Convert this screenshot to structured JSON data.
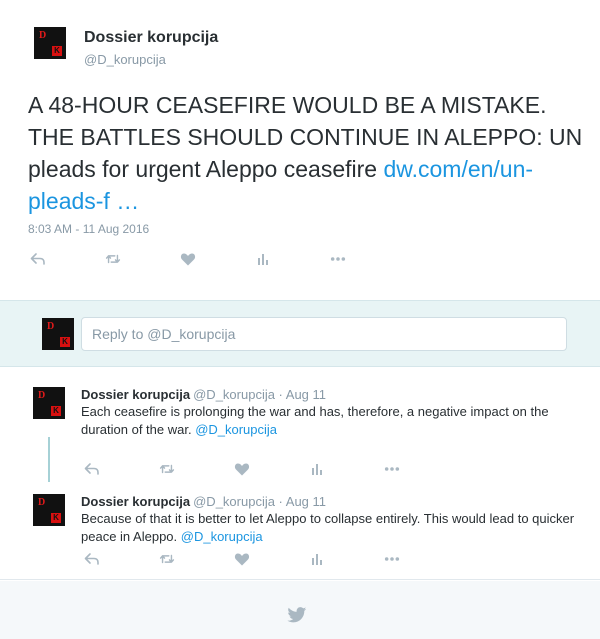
{
  "tweet": {
    "author_name": "Dossier korupcija",
    "author_handle": "@D_korupcija",
    "text": "A 48-HOUR CEASEFIRE WOULD BE A MISTAKE. THE BATTLES SHOULD CONTINUE IN ALEPPO: UN pleads for urgent Aleppo ceasefire ",
    "link": "dw.com/en/un-pleads-f  …",
    "timestamp": "8:03 AM - 11 Aug 2016",
    "actions": [
      "reply-icon",
      "retweet-icon",
      "like-icon",
      "analytics-icon",
      "more-icon"
    ]
  },
  "reply_box": {
    "placeholder": "Reply to @D_korupcija"
  },
  "replies": [
    {
      "author_name": "Dossier korupcija",
      "meta": "@D_korupcija · Aug 11",
      "text": "Each ceasefire is prolonging the war and has, therefore, a negative impact on the duration of the war. ",
      "mention": "@D_korupcija"
    },
    {
      "author_name": "Dossier korupcija",
      "meta": "@D_korupcija · Aug 11",
      "text": "Because of that it is better to let Aleppo to collapse entirely. This would lead to quicker peace in Aleppo. ",
      "mention": "@D_korupcija"
    }
  ],
  "footer": {
    "icon": "twitter-bird-icon"
  },
  "colors": {
    "link": "#1b95e0",
    "icon_gray": "#aab8c2",
    "reply_bar_bg": "#e8f4f5",
    "thread_line": "#a6d1d6"
  }
}
